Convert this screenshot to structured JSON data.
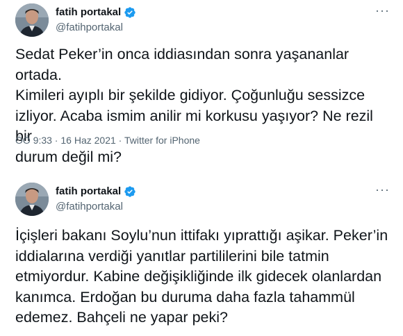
{
  "tweets": [
    {
      "display_name": "fatih portakal",
      "handle": "@fatihportakal",
      "more": "···",
      "text": "Sedat Peker’in onca iddiasından sonra yaşananlar ortada.\nKimileri ayıplı bir şekilde gidiyor. Çoğunluğu sessizce\nizliyor. Acaba ismim anilir mi korkusu yaşıyor? Ne rezil bir\ndurum değil mi?",
      "time": "ÖÖ 9:33",
      "sep1": " · ",
      "date": "16 Haz 2021",
      "sep2": " · ",
      "source": "Twitter for iPhone"
    },
    {
      "display_name": "fatih portakal",
      "handle": "@fatihportakal",
      "more": "···",
      "text": "İçişleri bakanı Soylu’nun ittifakı yıprattığı aşikar. Peker’in\niddialarına verdiği yanıtlar partililerini bile tatmin\netmiyordur. Kabine değişikliğinde ilk gidecek olanlardan\nkanımca. Erdoğan bu duruma daha fazla tahammül\nedemez. Bahçeli ne yapar peki?"
    }
  ],
  "colors": {
    "verified": "#1d9bf0",
    "secondary_text": "#536471",
    "primary_text": "#0f1419"
  }
}
